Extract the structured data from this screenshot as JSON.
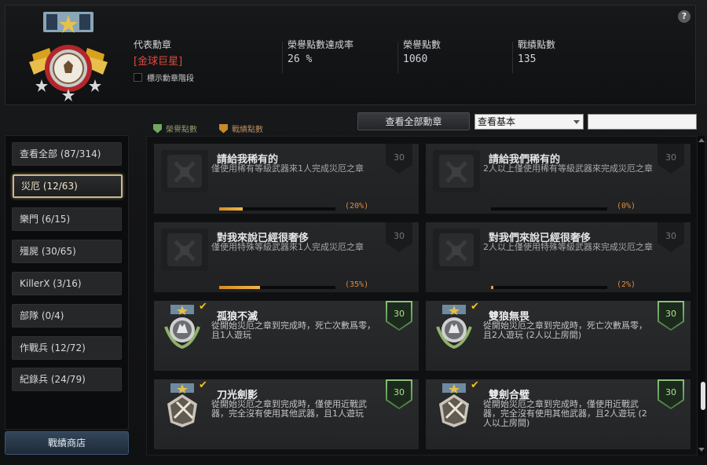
{
  "header": {
    "rep_label": "代表勳章",
    "rep_medal": "[金球巨星]",
    "show_stage": "標示勳章階段",
    "rate_label": "榮譽點數達成率",
    "rate_value": "26 %",
    "honor_label": "榮譽點數",
    "honor_value": "1060",
    "battle_label": "戰績點數",
    "battle_value": "135",
    "help": "?"
  },
  "legend": {
    "honor": "榮譽點數",
    "battle": "戰績點數"
  },
  "controls": {
    "view_all": "查看全部勳章",
    "select_value": "查看基本"
  },
  "colors": {
    "accent_gold": "#cbb88a",
    "progress": "#e9a73a",
    "earned_green": "#6fa860",
    "medal_red": "#e04a3e"
  },
  "sidebar": {
    "categories": [
      "查看全部 (87/314)",
      "災厄 (12/63)",
      "樂門 (6/15)",
      "殭屍 (30/65)",
      "KillerX (3/16)",
      "部隊 (0/4)",
      "作戰兵 (12/72)",
      "紀錄兵 (24/79)"
    ],
    "active": "災厄 (12/63)",
    "shop": "戰績商店"
  },
  "cards": [
    {
      "title": "請給我稀有的",
      "desc": "僅使用稀有等級武器來1人完成災厄之章",
      "points": "30",
      "progress": 0.2,
      "pct": "(20%)"
    },
    {
      "title": "請給我們稀有的",
      "desc": "2人以上僅使用稀有等級武器來完成災厄之章",
      "points": "30",
      "progress": 0.0,
      "pct": "(0%)"
    },
    {
      "title": "對我來說已經很奢侈",
      "desc": "僅使用特殊等級武器來1人完成災厄之章",
      "points": "30",
      "progress": 0.35,
      "pct": "(35%)"
    },
    {
      "title": "對我們來說已經很奢侈",
      "desc": "2人以上僅使用特殊等級武器來完成災厄之章",
      "points": "30",
      "progress": 0.02,
      "pct": "(2%)"
    },
    {
      "title": "孤狼不滅",
      "desc": "從開始災厄之章到完成時，死亡次數爲零，且1人遊玩",
      "points": "30"
    },
    {
      "title": "雙狼無畏",
      "desc": "從開始災厄之章到完成時，死亡次數爲零，且2人遊玩 (2人以上房間)",
      "points": "30"
    },
    {
      "title": "刀光劍影",
      "desc": "從開始災厄之章到完成時，僅使用近戰武器，完全沒有使用其他武器，且1人遊玩",
      "points": "30"
    },
    {
      "title": "雙劍合璧",
      "desc": "從開始災厄之章到完成時，僅使用近戰武器，完全沒有使用其他武器，且2人遊玩 (2人以上房間)",
      "points": "30"
    }
  ]
}
